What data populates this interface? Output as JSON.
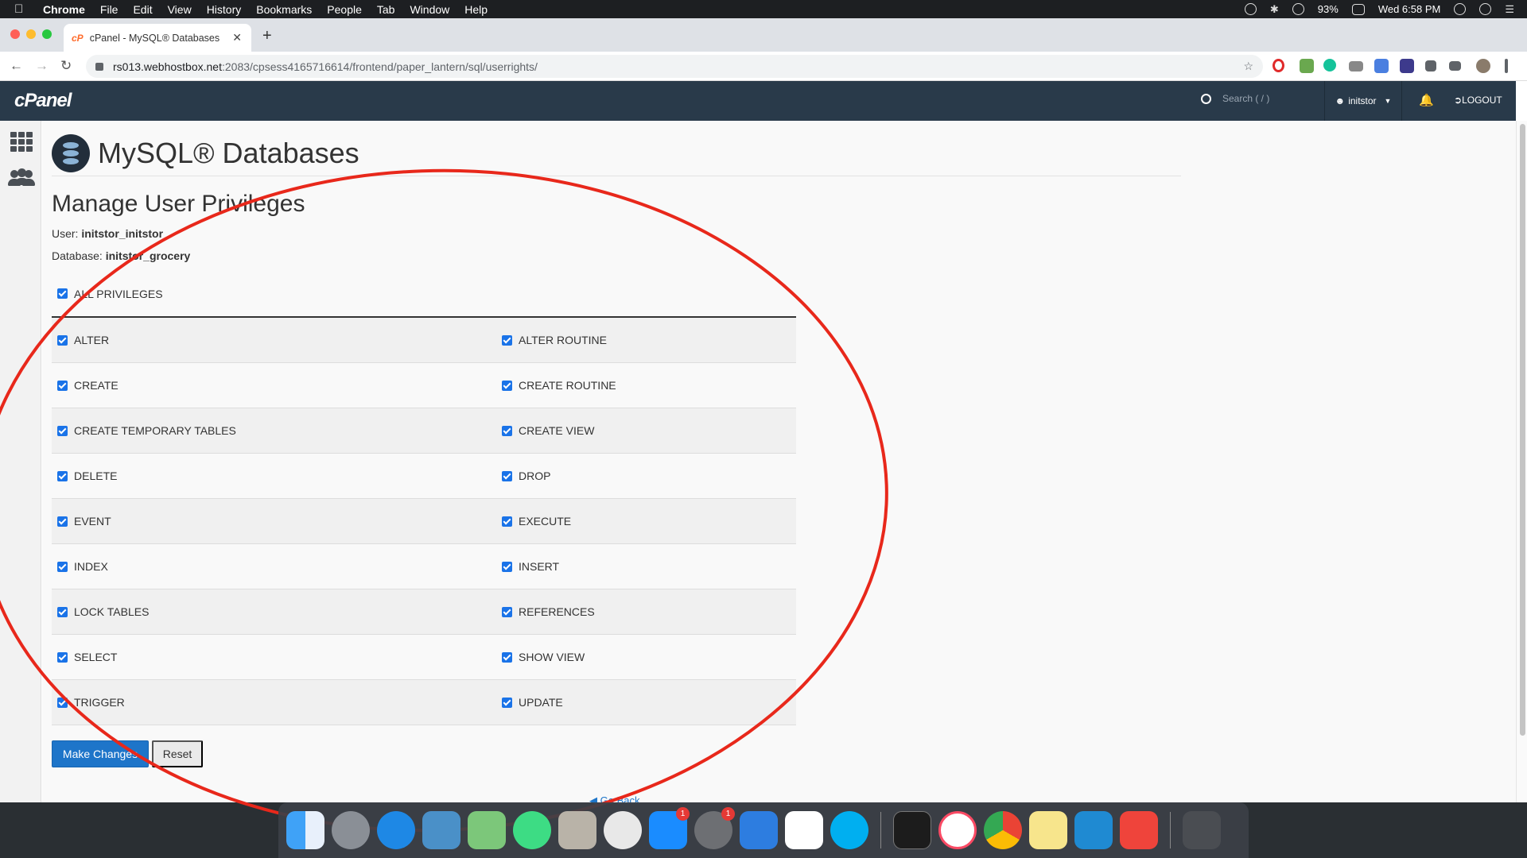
{
  "menubar": {
    "app": "Chrome",
    "items": [
      "File",
      "Edit",
      "View",
      "History",
      "Bookmarks",
      "People",
      "Tab",
      "Window",
      "Help"
    ],
    "battery": "93%",
    "clock": "Wed 6:58 PM"
  },
  "browser": {
    "tab_title": "cPanel - MySQL® Databases",
    "tab_favicon": "cP",
    "url_host": "rs013.webhostbox.net",
    "url_path": ":2083/cpsess4165716614/frontend/paper_lantern/sql/userrights/"
  },
  "cpanel": {
    "logo": "cPanel",
    "search_placeholder": "Search ( / )",
    "username": "initstor",
    "logout": "LOGOUT"
  },
  "page": {
    "title": "MySQL® Databases",
    "section_title": "Manage User Privileges",
    "user_label": "User:",
    "user_value": "initstor_initstor",
    "database_label": "Database:",
    "database_value": "initstor_grocery",
    "all_privileges": "ALL PRIVILEGES",
    "privileges": [
      [
        "ALTER",
        "ALTER ROUTINE"
      ],
      [
        "CREATE",
        "CREATE ROUTINE"
      ],
      [
        "CREATE TEMPORARY TABLES",
        "CREATE VIEW"
      ],
      [
        "DELETE",
        "DROP"
      ],
      [
        "EVENT",
        "EXECUTE"
      ],
      [
        "INDEX",
        "INSERT"
      ],
      [
        "LOCK TABLES",
        "REFERENCES"
      ],
      [
        "SELECT",
        "SHOW VIEW"
      ],
      [
        "TRIGGER",
        "UPDATE"
      ]
    ],
    "make_changes": "Make Changes",
    "reset": "Reset",
    "go_back": "Go Back"
  },
  "colors": {
    "cpanel_header": "#293a4a",
    "primary_button": "#1e75c9",
    "checkbox": "#1a73e8",
    "annotation": "#e8281b"
  },
  "dock": {
    "apps": [
      "finder",
      "launchpad",
      "safari",
      "preview",
      "maps",
      "android-studio",
      "calculator",
      "sequel-pro",
      "app-store",
      "system-preferences",
      "xcode",
      "slack",
      "skype",
      "terminal",
      "music",
      "chrome",
      "notes",
      "vscode",
      "anydesk",
      "trash"
    ],
    "badges": {
      "app-store": "1",
      "system-preferences": "1"
    }
  }
}
